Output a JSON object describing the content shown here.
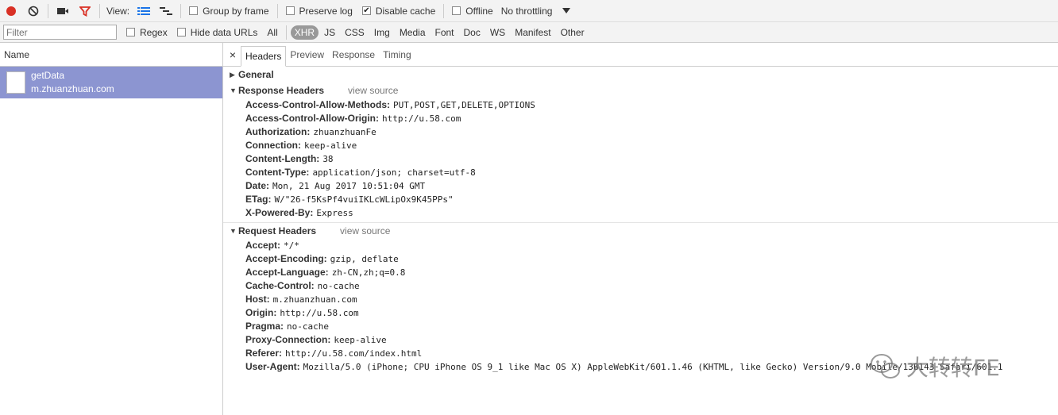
{
  "toolbar": {
    "view_label": "View:",
    "group_by_frame": "Group by frame",
    "preserve_log": "Preserve log",
    "disable_cache": "Disable cache",
    "offline": "Offline",
    "throttling": "No throttling",
    "record_color": "#d93025",
    "filter_icon_color": "#d93025"
  },
  "filterbar": {
    "placeholder": "Filter",
    "regex": "Regex",
    "hide_data_urls": "Hide data URLs",
    "types": [
      "All",
      "XHR",
      "JS",
      "CSS",
      "Img",
      "Media",
      "Font",
      "Doc",
      "WS",
      "Manifest",
      "Other"
    ],
    "active_type": "XHR"
  },
  "left": {
    "name_header": "Name",
    "request": {
      "name": "getData",
      "domain": "m.zhuanzhuan.com"
    },
    "selected_color": "#8c95d1"
  },
  "tabs": [
    "Headers",
    "Preview",
    "Response",
    "Timing"
  ],
  "general": {
    "title": "General"
  },
  "response_headers": {
    "title": "Response Headers",
    "view_source": "view source",
    "items": [
      {
        "k": "Access-Control-Allow-Methods:",
        "v": "PUT,POST,GET,DELETE,OPTIONS"
      },
      {
        "k": "Access-Control-Allow-Origin:",
        "v": "http://u.58.com"
      },
      {
        "k": "Authorization:",
        "v": "zhuanzhuanFe"
      },
      {
        "k": "Connection:",
        "v": "keep-alive"
      },
      {
        "k": "Content-Length:",
        "v": "38"
      },
      {
        "k": "Content-Type:",
        "v": "application/json; charset=utf-8"
      },
      {
        "k": "Date:",
        "v": "Mon, 21 Aug 2017 10:51:04 GMT"
      },
      {
        "k": "ETag:",
        "v": "W/\"26-f5KsPf4vuiIKLcWLipOx9K45PPs\""
      },
      {
        "k": "X-Powered-By:",
        "v": "Express"
      }
    ]
  },
  "request_headers": {
    "title": "Request Headers",
    "view_source": "view source",
    "items": [
      {
        "k": "Accept:",
        "v": "*/*"
      },
      {
        "k": "Accept-Encoding:",
        "v": "gzip, deflate"
      },
      {
        "k": "Accept-Language:",
        "v": "zh-CN,zh;q=0.8"
      },
      {
        "k": "Cache-Control:",
        "v": "no-cache"
      },
      {
        "k": "Host:",
        "v": "m.zhuanzhuan.com"
      },
      {
        "k": "Origin:",
        "v": "http://u.58.com"
      },
      {
        "k": "Pragma:",
        "v": "no-cache"
      },
      {
        "k": "Proxy-Connection:",
        "v": "keep-alive"
      },
      {
        "k": "Referer:",
        "v": "http://u.58.com/index.html"
      },
      {
        "k": "User-Agent:",
        "v": "Mozilla/5.0 (iPhone; CPU iPhone OS 9_1 like Mac OS X) AppleWebKit/601.1.46 (KHTML, like Gecko) Version/9.0 Mobile/13B143 Safari/601.1"
      }
    ]
  },
  "watermark": {
    "text": "大转转FE",
    "icon": "wechat-icon"
  }
}
